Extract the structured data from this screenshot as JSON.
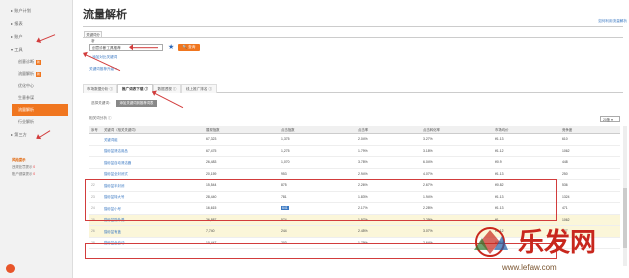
{
  "sidebar": {
    "items": [
      {
        "label": "账户计划",
        "icon": "arrow"
      },
      {
        "label": "报表",
        "icon": "arrow"
      },
      {
        "label": "账户",
        "icon": "arrow"
      },
      {
        "label": "工具",
        "icon": "arrow"
      }
    ],
    "tools": [
      {
        "label": "创意诊断",
        "tag": "新"
      },
      {
        "label": "流量解析",
        "tag": "新"
      },
      {
        "label": "优化中心",
        "tag": ""
      },
      {
        "label": "生意参谋",
        "tag": ""
      },
      {
        "label": "流量解析",
        "tag": ""
      },
      {
        "label": "行业解析",
        "tag": ""
      }
    ],
    "third_party": "第三方",
    "warning": {
      "title": "风险提示",
      "rows": [
        {
          "label": "违规处罚提示",
          "value": "0"
        },
        {
          "label": "账户健康提示",
          "value": "0"
        }
      ]
    }
  },
  "header": {
    "title": "流量解析",
    "top_link": "如何利用流量解析"
  },
  "keyword": {
    "tab_label": "关键词分析",
    "input_value": "创意诊断工具推荐",
    "search_label": "查询",
    "add_keyword": "+ 添加对比关键词",
    "upgrade": "关键词推荐升级"
  },
  "tabs": [
    {
      "label": "市场数据分析"
    },
    {
      "label": "推广词表下载"
    },
    {
      "label": "数据透视"
    },
    {
      "label": "线上推广排名"
    }
  ],
  "filter": {
    "label": "选择关键词：",
    "button": "添加关键词到推荐词表"
  },
  "analysis": {
    "label": "相关词分析",
    "page_select": "20条"
  },
  "table": {
    "headers": [
      "序号",
      "关键词（相关关键词）",
      "展现指数",
      "点击指数",
      "点击率",
      "点击转化率",
      "市场均价",
      "竞争度"
    ],
    "rows": [
      {
        "idx": "",
        "kw": "关键词组",
        "v1": "67,323",
        "v2": "1,375",
        "v3": "2.04%",
        "v4": "3.27%",
        "v5": "¥1.13",
        "v6": "610",
        "style": "normal",
        "hl": false
      },
      {
        "idx": "",
        "kw": "猫砂盆清洁用品",
        "v1": "67,475",
        "v2": "1,275",
        "v3": "1.79%",
        "v4": "3.18%",
        "v5": "¥1.12",
        "v6": "1062",
        "style": "normal",
        "hl": false
      },
      {
        "idx": "",
        "kw": "猫砂盆自动清洁器",
        "v1": "26,483",
        "v2": "1,070",
        "v3": "3.78%",
        "v4": "6.04%",
        "v5": "¥0.9",
        "v6": "448",
        "style": "normal",
        "hl": false
      },
      {
        "idx": "",
        "kw": "猫砂盆全封闭式",
        "v1": "20,159",
        "v2": "953",
        "v3": "2.94%",
        "v4": "4.07%",
        "v5": "¥1.13",
        "v6": "250",
        "style": "normal",
        "hl": false
      },
      {
        "idx": "22",
        "kw": "猫砂盆半封闭",
        "v1": "15,544",
        "v2": "875",
        "v3": "2.26%",
        "v4": "2.67%",
        "v5": "¥0.82",
        "v6": "536",
        "style": "normal",
        "hl": false
      },
      {
        "idx": "23",
        "kw": "猫砂盆特大号",
        "v1": "28,440",
        "v2": "781",
        "v3": "1.83%",
        "v4": "1.94%",
        "v5": "¥1.13",
        "v6": "1324",
        "style": "normal",
        "hl": false
      },
      {
        "idx": "24",
        "kw": "猫砂盆小号",
        "v1": "16,615",
        "v2": "641",
        "v3": "2.17%",
        "v4": "2.28%",
        "v5": "¥1.13",
        "v6": "471",
        "style": "normal",
        "hl": true
      },
      {
        "idx": "25",
        "kw": "猫砂盆防外溅",
        "v1": "26,887",
        "v2": "574",
        "v3": "1.97%",
        "v4": "2.29%",
        "v5": "¥1",
        "v6": "1062",
        "style": "yellow",
        "hl": false
      },
      {
        "idx": "26",
        "kw": "猫砂盆有盖",
        "v1": "7,740",
        "v2": "244",
        "v3": "2.45%",
        "v4": "3.07%",
        "v5": "¥1.12",
        "v6": "327",
        "style": "yellow",
        "hl": false
      },
      {
        "idx": "28",
        "kw": "猫砂盆全自动",
        "v1": "10,447",
        "v2": "203",
        "v3": "1.79%",
        "v4": "2.64%",
        "v5": "¥0.84",
        "v6": "",
        "style": "normal",
        "hl": false
      }
    ]
  },
  "watermark": {
    "brand": "乐发网",
    "url": "www.lefaw.com"
  },
  "colors": {
    "accent": "#f0761f",
    "link": "#3a78c2",
    "annotation": "#d23c3c",
    "highlight_row": "#fbf6d9"
  }
}
